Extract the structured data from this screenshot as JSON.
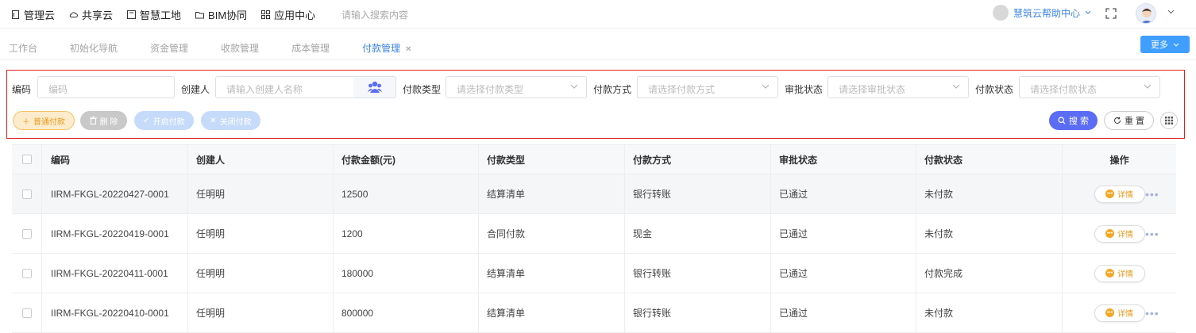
{
  "topnav": [
    {
      "label": "管理云",
      "icon": "doc-icon"
    },
    {
      "label": "共享云",
      "icon": "cloud-icon"
    },
    {
      "label": "智慧工地",
      "icon": "book-icon"
    },
    {
      "label": "BIM协同",
      "icon": "folder-icon"
    },
    {
      "label": "应用中心",
      "icon": "grid-icon"
    }
  ],
  "search": {
    "placeholder": "请输入搜索内容"
  },
  "help": {
    "label": "慧筑云帮助中心"
  },
  "tabs": [
    {
      "label": "工作台",
      "active": false
    },
    {
      "label": "初始化导航",
      "active": false
    },
    {
      "label": "资金管理",
      "active": false
    },
    {
      "label": "收款管理",
      "active": false
    },
    {
      "label": "成本管理",
      "active": false
    },
    {
      "label": "付款管理",
      "active": true,
      "closable": true
    }
  ],
  "more_label": "更多",
  "filters": {
    "code_label": "编码",
    "code_placeholder": "编码",
    "creator_label": "创建人",
    "creator_placeholder": "请输入创建人名称",
    "paytype_label": "付款类型",
    "paytype_placeholder": "请选择付款类型",
    "paymethod_label": "付款方式",
    "paymethod_placeholder": "请选择付款方式",
    "approval_label": "审批状态",
    "approval_placeholder": "请选择审批状态",
    "paystatus_label": "付款状态",
    "paystatus_placeholder": "请选择付款状态"
  },
  "actions": {
    "add": "普通付款",
    "delete": "删 除",
    "open": "开启付款",
    "close": "关闭付款",
    "search": "搜 索",
    "reset": "重 置"
  },
  "table": {
    "headers": [
      "编码",
      "创建人",
      "付款金额(元)",
      "付款类型",
      "付款方式",
      "审批状态",
      "付款状态",
      "操作"
    ],
    "rows": [
      {
        "code": "IIRM-FKGL-20220427-0001",
        "creator": "任明明",
        "amount": "12500",
        "type": "结算清单",
        "method": "银行转账",
        "approval": "已通过",
        "status": "未付款",
        "more": true
      },
      {
        "code": "IIRM-FKGL-20220419-0001",
        "creator": "任明明",
        "amount": "1200",
        "type": "合同付款",
        "method": "现金",
        "approval": "已通过",
        "status": "未付款",
        "more": true
      },
      {
        "code": "IIRM-FKGL-20220411-0001",
        "creator": "任明明",
        "amount": "180000",
        "type": "结算清单",
        "method": "银行转账",
        "approval": "已通过",
        "status": "付款完成",
        "more": false
      },
      {
        "code": "IIRM-FKGL-20220410-0001",
        "creator": "任明明",
        "amount": "800000",
        "type": "结算清单",
        "method": "银行转账",
        "approval": "已通过",
        "status": "未付款",
        "more": true
      }
    ],
    "detail_label": "详情"
  },
  "colors": {
    "accent": "#3b84e6",
    "primary_button": "#5b6cf5",
    "warning": "#f5a623",
    "highlight_border": "#e02020"
  }
}
